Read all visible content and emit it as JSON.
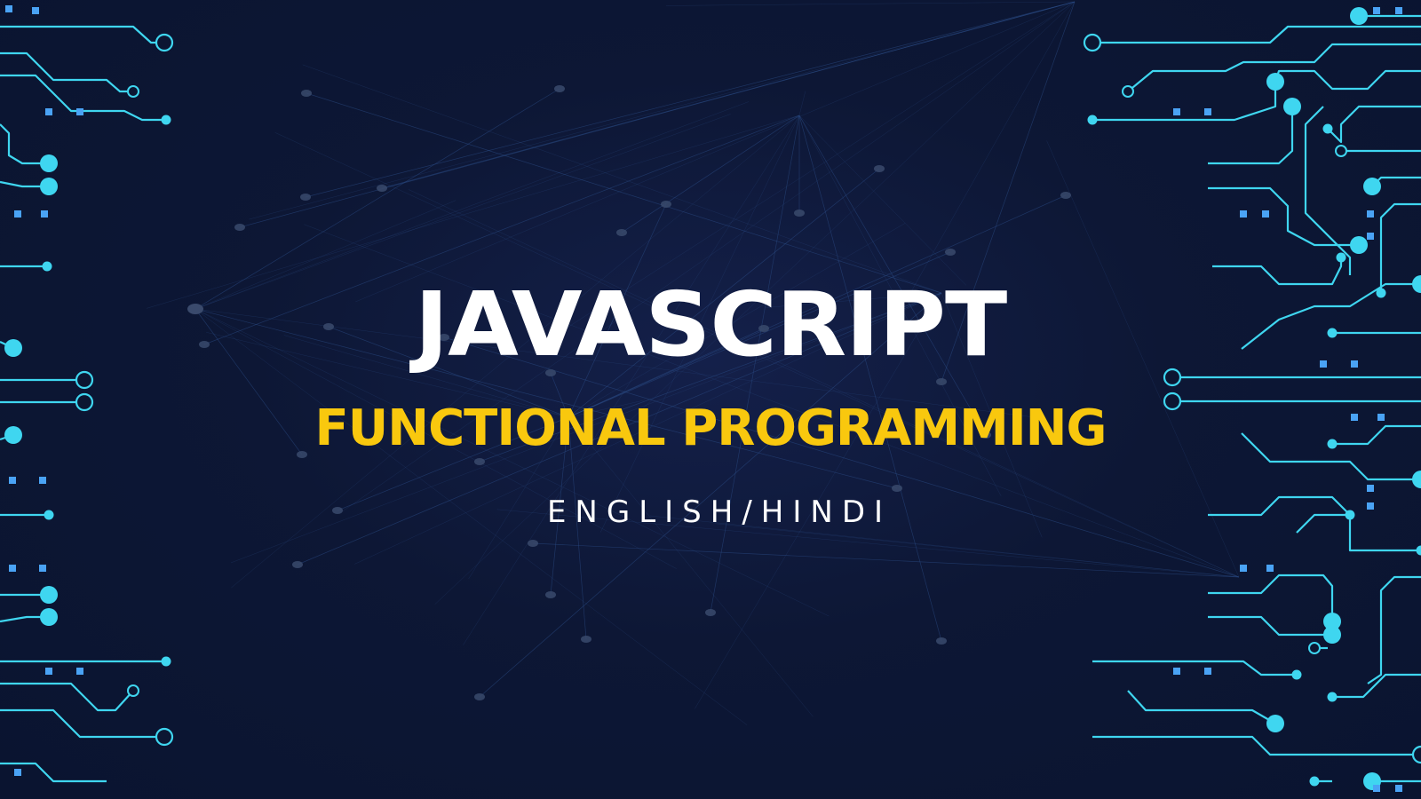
{
  "banner": {
    "title": "JAVASCRIPT",
    "subtitle": "FUNCTIONAL PROGRAMMING",
    "language": "ENGLISH/HINDI"
  },
  "colors": {
    "background": "#0c1632",
    "title": "#ffffff",
    "subtitle": "#f9c80e",
    "circuit": "#3fd6f0",
    "network": "#2b4c86"
  },
  "decor": {
    "left_panel": "circuit-board-icon",
    "right_panel": "circuit-board-icon",
    "backdrop": "network-mesh-icon"
  }
}
